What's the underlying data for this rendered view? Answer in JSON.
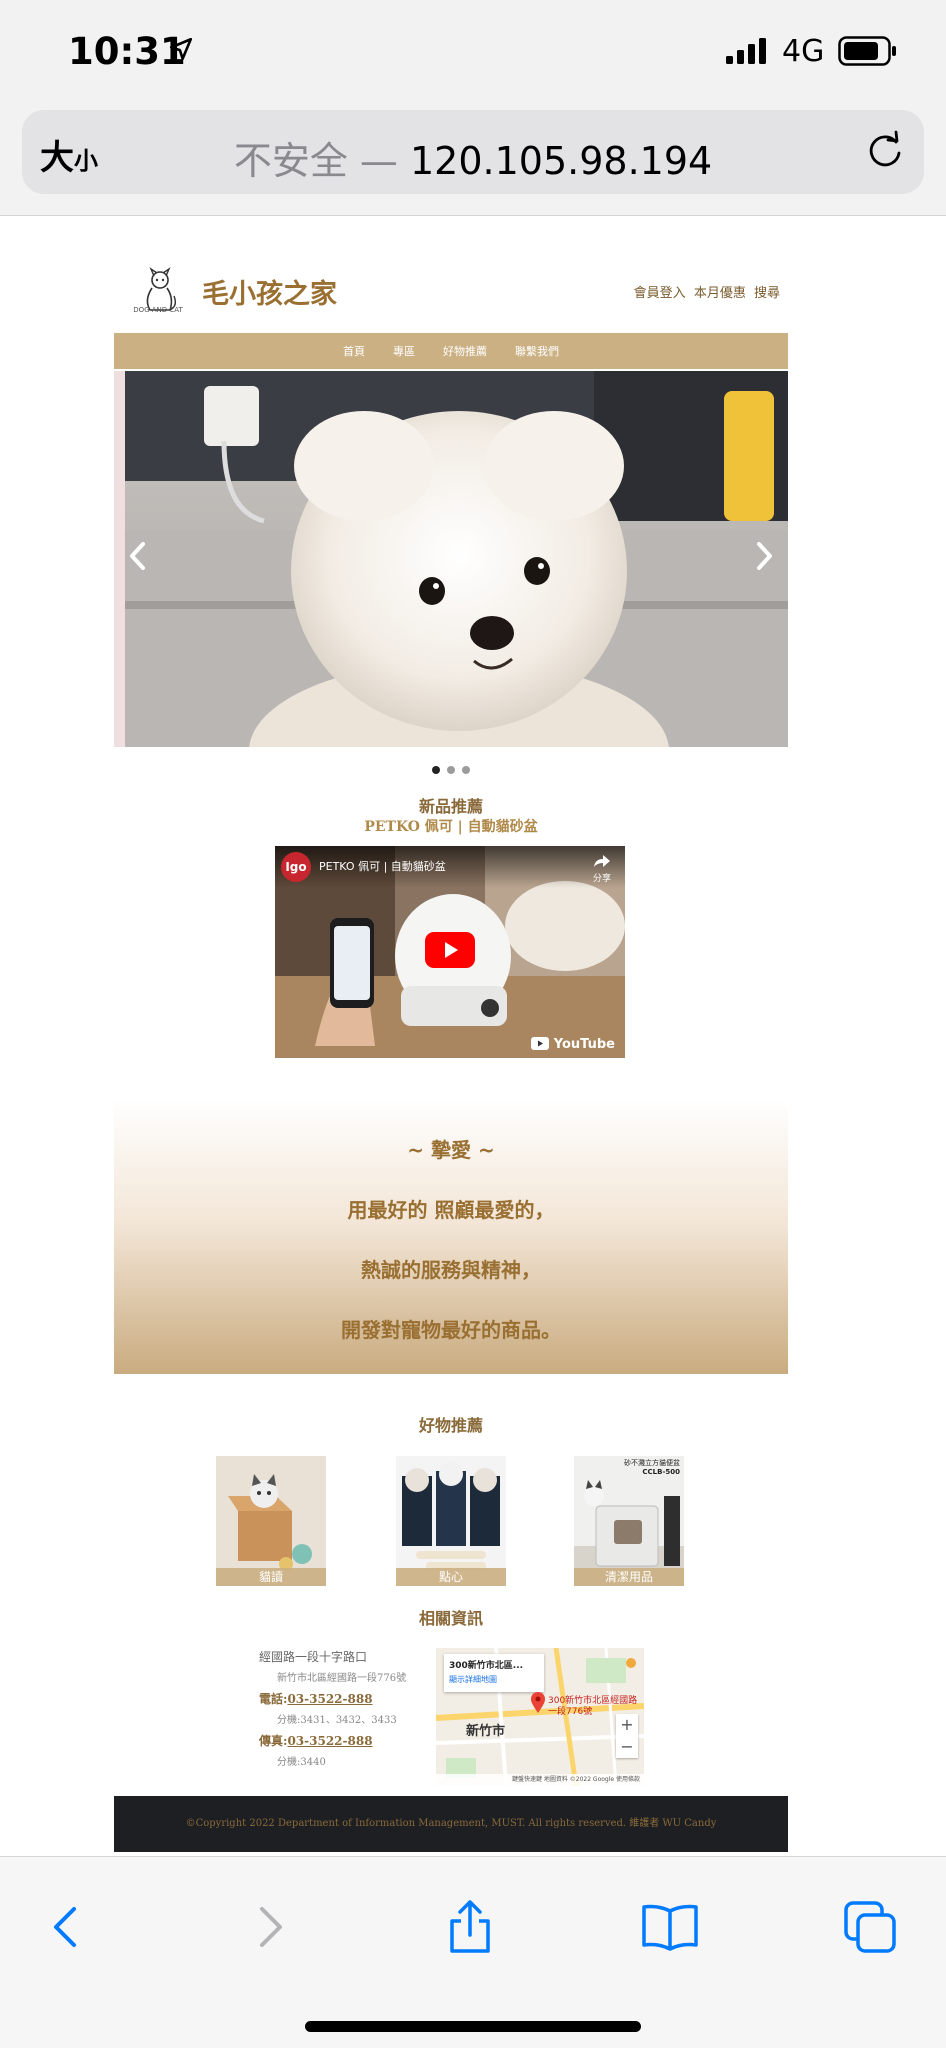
{
  "status_bar": {
    "time": "10:31",
    "network": "4G"
  },
  "browser": {
    "text_size_label": "大",
    "text_size_small": "小",
    "insecure_label": "不安全",
    "separator": " — ",
    "host": "120.105.98.194"
  },
  "site": {
    "logo_caption": "DOG AND CAT",
    "title": "毛小孩之家",
    "header_links": [
      "會員登入",
      "本月優惠",
      "搜尋"
    ],
    "nav": [
      "首頁",
      "專區",
      "好物推薦",
      "聯繫我們"
    ],
    "carousel": {
      "slides": 3,
      "active_index": 0
    }
  },
  "new_products": {
    "heading": "新品推薦",
    "subheading": "PETKO 佩可 | 自動貓砂盆",
    "video": {
      "channel_badge": "Igo",
      "title": "PETKO 佩可 | 自動貓砂盆",
      "share_label": "分享",
      "platform": "YouTube"
    }
  },
  "promo": {
    "title": "~   摯愛   ~",
    "lines": [
      "用最好的 照顧最愛的，",
      "熱誠的服務與精神，",
      "開發對寵物最好的商品。"
    ]
  },
  "recommend": {
    "heading": "好物推薦",
    "items": [
      {
        "label": "貓讀"
      },
      {
        "label": "點心"
      },
      {
        "label": "清潔用品",
        "overlay_text": "砂不濺立方貓便盆",
        "overlay_code": "CCLB-500"
      }
    ]
  },
  "contact": {
    "heading": "相關資訊",
    "location": "經國路一段十字路口",
    "address": "新竹市北區經國路一段776號",
    "phone_label": "電話:",
    "phone": "03-3522-888",
    "phone_ext": "分機:3431、3432、3433",
    "fax_label": "傳真:",
    "fax": "03-3522-888",
    "fax_ext": "分機:3440",
    "map": {
      "card_title": "300新竹市北區...",
      "card_link": "顯示詳細地圖",
      "city": "新竹市",
      "pin_address": "300新竹市北區經國路一段776號",
      "attribution": "鍵盤快速鍵  地圖資料 ©2022 Google  使用條款"
    }
  },
  "footer": {
    "text": "©Copyright 2022 Department of Information Management, MUST. All rights reserved. 維護者 WU Candy"
  },
  "colors": {
    "brand": "#9a6f32",
    "nav_bg": "#cbb083",
    "footer_bg": "#1e1f22",
    "ios_blue": "#007aff"
  }
}
